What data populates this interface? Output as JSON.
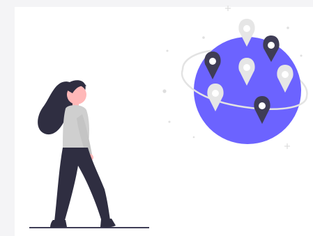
{
  "illustration": {
    "subject": "person-looking-at-globe-with-location-pins",
    "colors": {
      "background": "#f4f4f6",
      "card": "#ffffff",
      "globe": "#6c63ff",
      "orbit": "#e6e6e6",
      "pin_light": "#e6e6e6",
      "pin_dark": "#3f3d56",
      "hair_and_pants": "#2f2e41",
      "sweater": "#cfcfcf",
      "skin": "#ffb8b8",
      "ground": "#3f3d56"
    },
    "pins": [
      {
        "tone": "light"
      },
      {
        "tone": "dark"
      },
      {
        "tone": "dark"
      },
      {
        "tone": "light"
      },
      {
        "tone": "light"
      },
      {
        "tone": "light"
      },
      {
        "tone": "dark"
      }
    ]
  }
}
